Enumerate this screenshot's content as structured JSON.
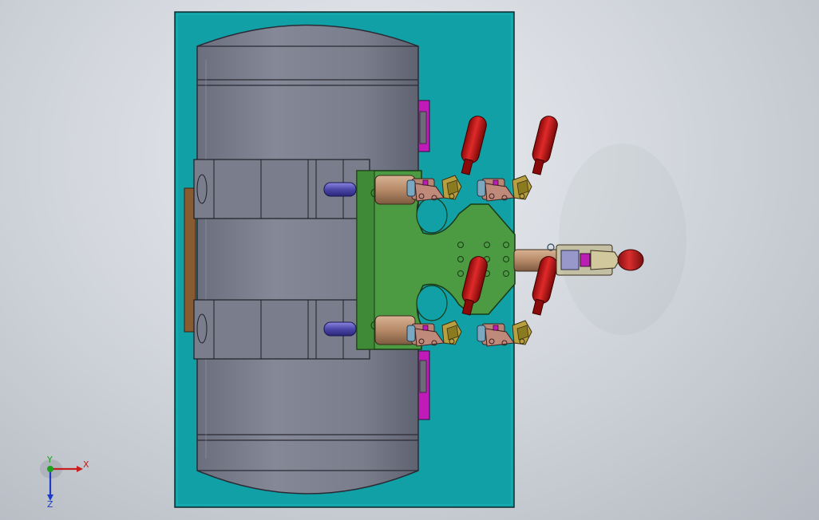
{
  "viewport": {
    "background_top": "#e9ecf0",
    "background_bottom": "#b4b9c1"
  },
  "model": {
    "base_plate_color": "#10a0a6",
    "tank_color": "#777a88",
    "fixture_plate_color": "#4c9a42",
    "handle_color": "#d01818",
    "clamp_color": "#c08a7a",
    "spacer_color": "#c01ab8",
    "pin_color": "#5a55b8",
    "shaft_color": "#b68a68",
    "bracket_color": "#8a5a30"
  },
  "triad": {
    "x_label": "X",
    "y_label": "Y",
    "z_label": "Z",
    "x_color": "#c81e1e",
    "y_color": "#1ea01e",
    "z_color": "#1e3ac8"
  }
}
